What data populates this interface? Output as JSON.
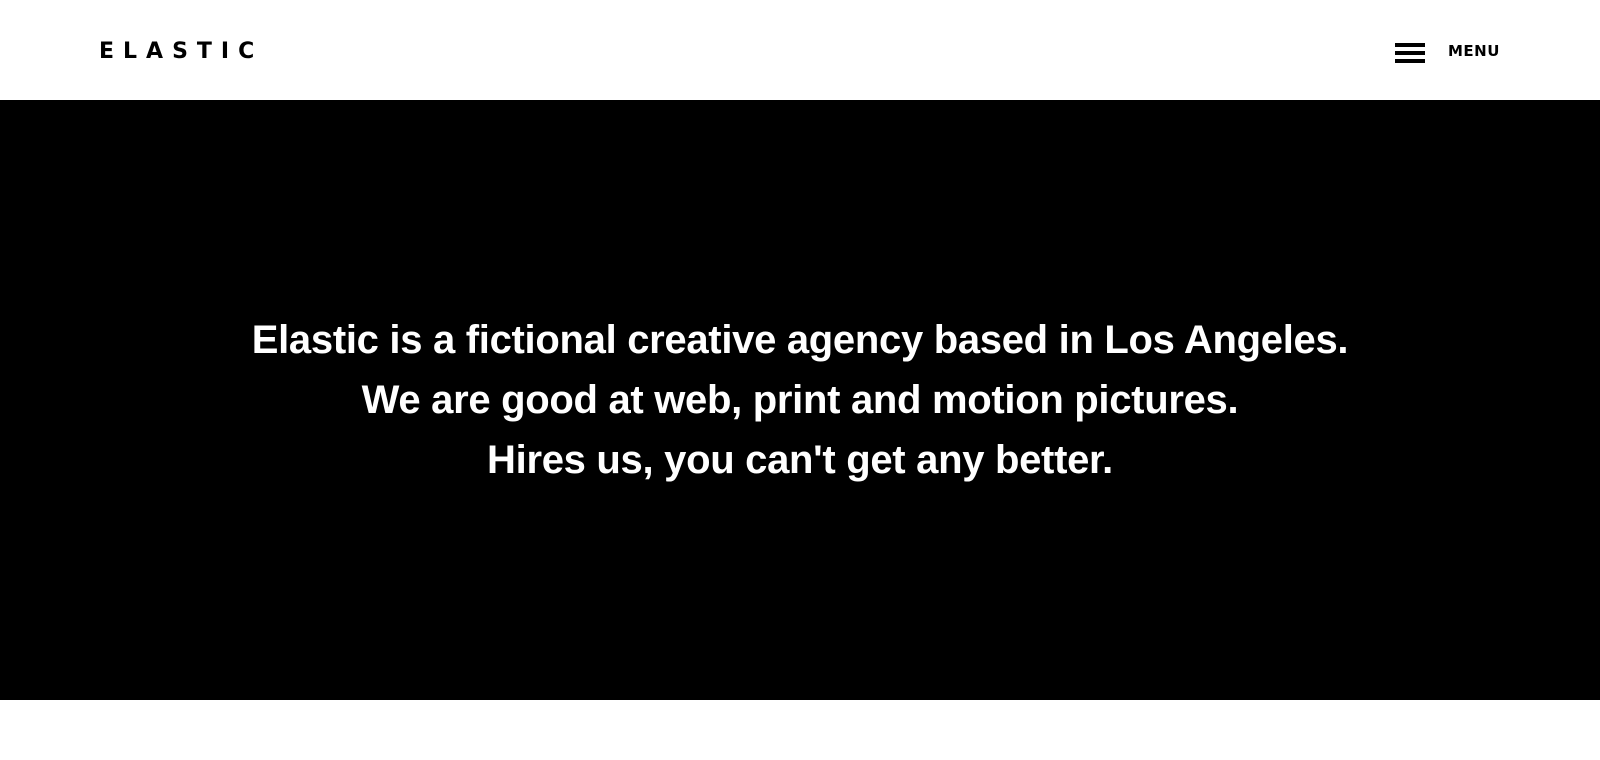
{
  "header": {
    "logo": "ELASTIC",
    "menu_label": "MENU",
    "menu_icon": "hamburger-icon"
  },
  "hero": {
    "lines": [
      "Elastic is a fictional creative agency based in Los Angeles.",
      "We are good at web, print and motion pictures.",
      "Hires us, you can't get any better."
    ]
  },
  "colors": {
    "hero_background": "#000000",
    "hero_text": "#ffffff",
    "header_background": "#ffffff",
    "header_text": "#000000"
  }
}
